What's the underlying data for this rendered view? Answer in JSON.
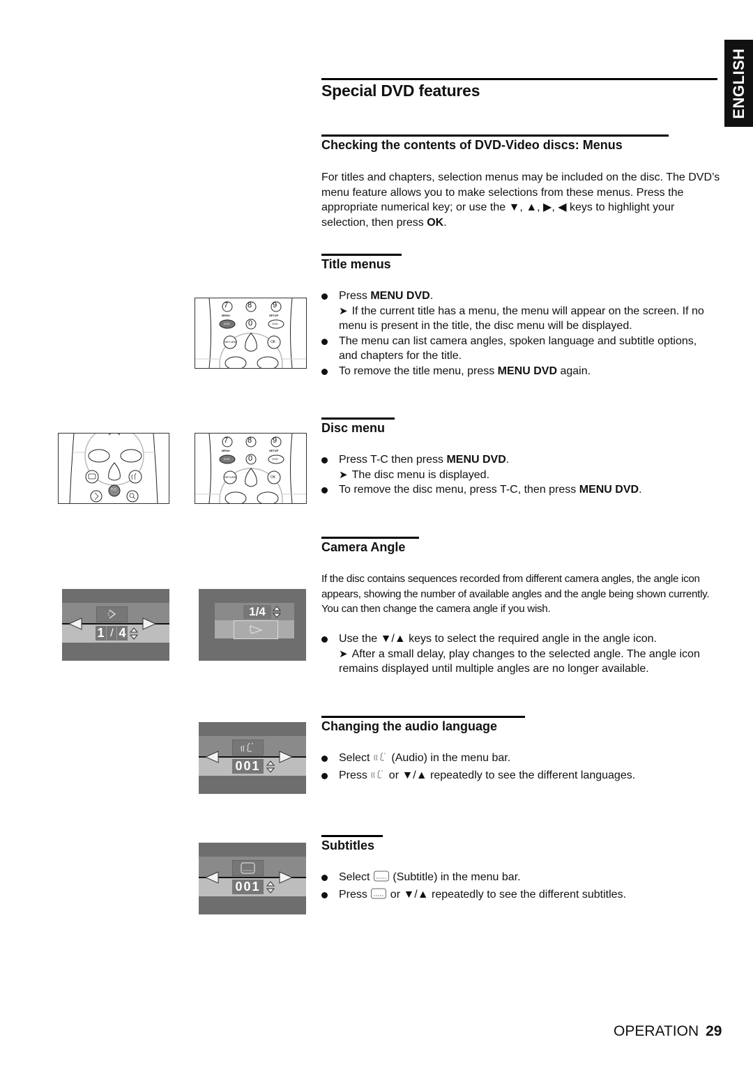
{
  "page": {
    "title": "Special DVD features",
    "language_tab": "ENGLISH",
    "footer": {
      "section": "OPERATION",
      "page_number": "29"
    }
  },
  "sections": {
    "menus": {
      "heading": "Checking the contents of DVD-Video discs: Menus",
      "intro_1": "For titles and chapters, selection menus may be included on the disc. The DVD’s menu feature allows you to make selections from these menus. Press the appropriate numerical key; or use the ▼, ▲, ▶, ◀ keys to highlight your selection, then press ",
      "intro_ok": "OK",
      "intro_end": "."
    },
    "title_menus": {
      "heading": "Title menus",
      "b1_pre": "Press ",
      "b1_bold": "MENU DVD",
      "b1_post": ".",
      "b1_note": "If the current title has a menu, the menu will appear on the screen. If no menu is present in the title, the disc menu will be displayed.",
      "b2": "The menu can list camera angles, spoken language and subtitle options, and chapters for the title.",
      "b3_pre": "To remove the title menu, press ",
      "b3_bold": "MENU DVD",
      "b3_post": " again."
    },
    "disc_menu": {
      "heading": "Disc menu",
      "b1_pre": "Press T-C then press ",
      "b1_bold": "MENU DVD",
      "b1_post": ".",
      "b1_note": "The disc menu is displayed.",
      "b2_pre": "To remove the disc menu, press T-C, then press ",
      "b2_bold": "MENU DVD",
      "b2_post": "."
    },
    "camera_angle": {
      "heading": "Camera Angle",
      "intro": "If the disc contains sequences recorded from different camera angles, the angle icon appears, showing the number of available angles and the angle being shown currently. You can then change the camera angle if you wish.",
      "b1": "Use the ▼/▲ keys to select the required angle in the angle icon.",
      "b1_note": "After a small delay, play changes to the selected angle. The angle icon remains displayed until multiple angles are no longer available."
    },
    "audio": {
      "heading": "Changing the audio language",
      "b1_pre": "Select ",
      "b1_post": " (Audio) in the menu bar.",
      "b2_pre": "Press ",
      "b2_post": " or ▼/▲ repeatedly to see the different languages."
    },
    "subtitles": {
      "heading": "Subtitles",
      "b1_pre": "Select ",
      "b1_post": " (Subtitle) in the menu bar.",
      "b2_pre": "Press ",
      "b2_post": " or ▼/▲ repeatedly to see the different subtitles."
    }
  },
  "illustrations": {
    "remote_top": {
      "keys": [
        "7",
        "8",
        "9",
        "0"
      ],
      "menu_label": "MENU",
      "dvd_label": "DVD",
      "setup_label": "SETUP",
      "osd_label": "OSD",
      "return_label": "RETURN",
      "ok_label": "OK"
    },
    "remote_tc": {
      "tc_label": "T-C"
    },
    "osd_angle_bar": {
      "current": "1",
      "separator": "/",
      "total": "4"
    },
    "osd_angle_box": {
      "value": "1/4"
    },
    "osd_audio": {
      "value": "001"
    },
    "osd_subtitle": {
      "value": "001"
    }
  },
  "colors": {
    "ink": "#111111",
    "osd_dark": "#6e6e6e",
    "osd_mid": "#8a8a8a",
    "osd_light": "#bdbdbd",
    "dvd_key": "#777777"
  }
}
